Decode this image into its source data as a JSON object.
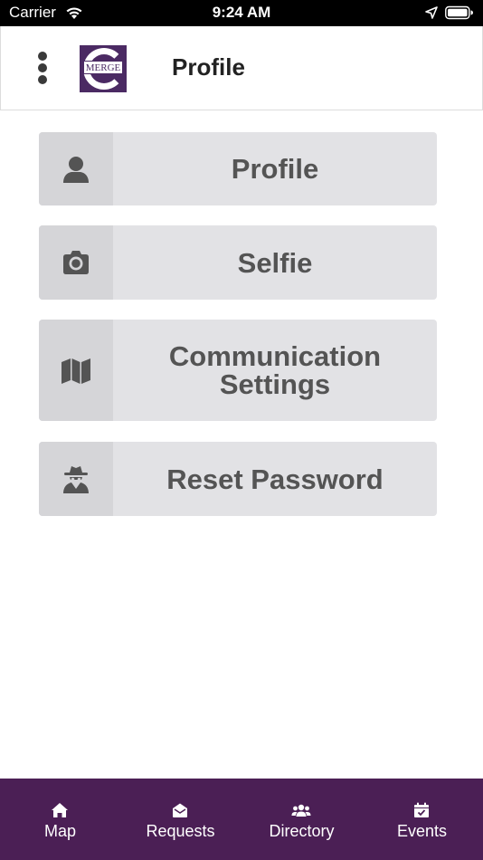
{
  "status_bar": {
    "carrier": "Carrier",
    "time": "9:24 AM"
  },
  "header": {
    "title": "Profile",
    "logo_text": "MERGE"
  },
  "menu": {
    "items": [
      {
        "label": "Profile",
        "icon": "user-icon"
      },
      {
        "label": "Selfie",
        "icon": "camera-icon"
      },
      {
        "label_line1": "Communication",
        "label_line2": "Settings",
        "icon": "map-icon"
      },
      {
        "label": "Reset Password",
        "icon": "spy-icon"
      }
    ]
  },
  "tab_bar": {
    "background": "#4b1f55",
    "tabs": [
      {
        "label": "Map",
        "icon": "home-icon"
      },
      {
        "label": "Requests",
        "icon": "envelope-open-icon"
      },
      {
        "label": "Directory",
        "icon": "users-icon"
      },
      {
        "label": "Events",
        "icon": "calendar-check-icon"
      }
    ]
  },
  "colors": {
    "brand": "#4b2a63",
    "card_bg": "#e2e2e5",
    "card_icon_bg": "#d5d5d8",
    "card_text": "#545454"
  }
}
